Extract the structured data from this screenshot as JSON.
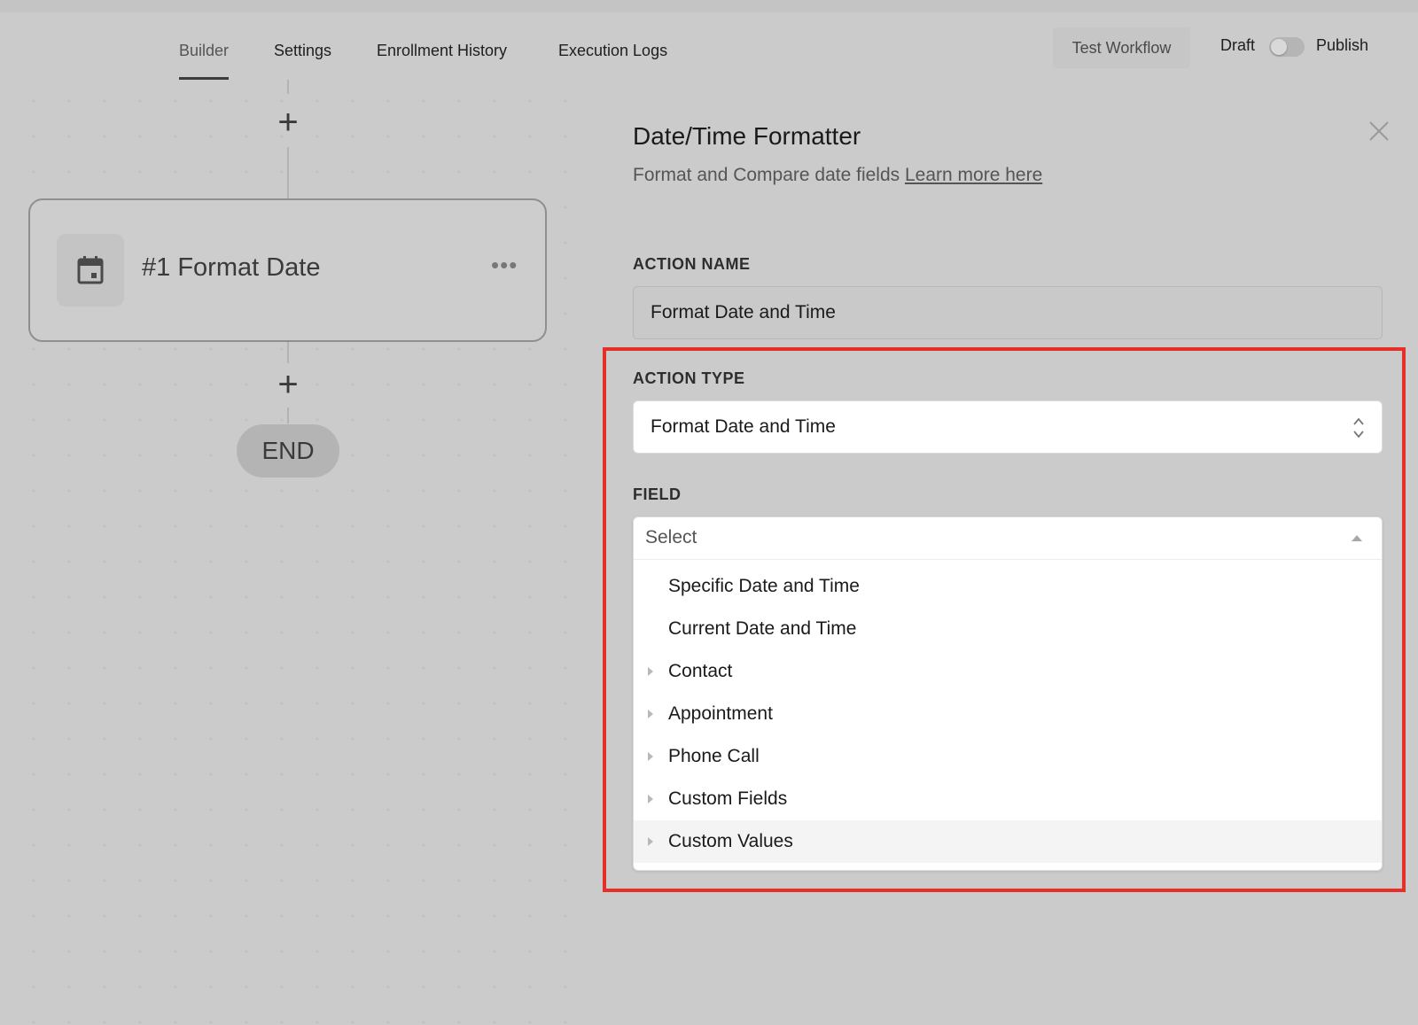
{
  "topbar": {
    "tabs": [
      {
        "label": "Builder",
        "active": true
      },
      {
        "label": "Settings",
        "active": false
      },
      {
        "label": "Enrollment History",
        "active": false
      },
      {
        "label": "Execution Logs",
        "active": false
      }
    ],
    "test_workflow_label": "Test Workflow",
    "draft_label": "Draft",
    "publish_label": "Publish",
    "publish_toggle_on": false
  },
  "canvas": {
    "node": {
      "title": "#1 Format Date",
      "icon": "calendar-icon",
      "more_label": "•••"
    },
    "add_step_symbol": "+",
    "end_label": "END"
  },
  "panel": {
    "title": "Date/Time Formatter",
    "subtitle": "Format and Compare date fields",
    "learn_more_link": "Learn more here",
    "action_name": {
      "label": "ACTION NAME",
      "value": "Format Date and Time"
    },
    "action_type": {
      "label": "ACTION TYPE",
      "value": "Format Date and Time"
    },
    "field": {
      "label": "FIELD",
      "placeholder": "Select",
      "options": [
        {
          "label": "Specific Date and Time",
          "expandable": false
        },
        {
          "label": "Current Date and Time",
          "expandable": false
        },
        {
          "label": "Contact",
          "expandable": true
        },
        {
          "label": "Appointment",
          "expandable": true
        },
        {
          "label": "Phone Call",
          "expandable": true
        },
        {
          "label": "Custom Fields",
          "expandable": true
        },
        {
          "label": "Custom Values",
          "expandable": true,
          "hovered": true
        }
      ]
    }
  },
  "colors": {
    "highlight_border": "#e5302a",
    "overlay_gray": "#cbcbcb"
  }
}
